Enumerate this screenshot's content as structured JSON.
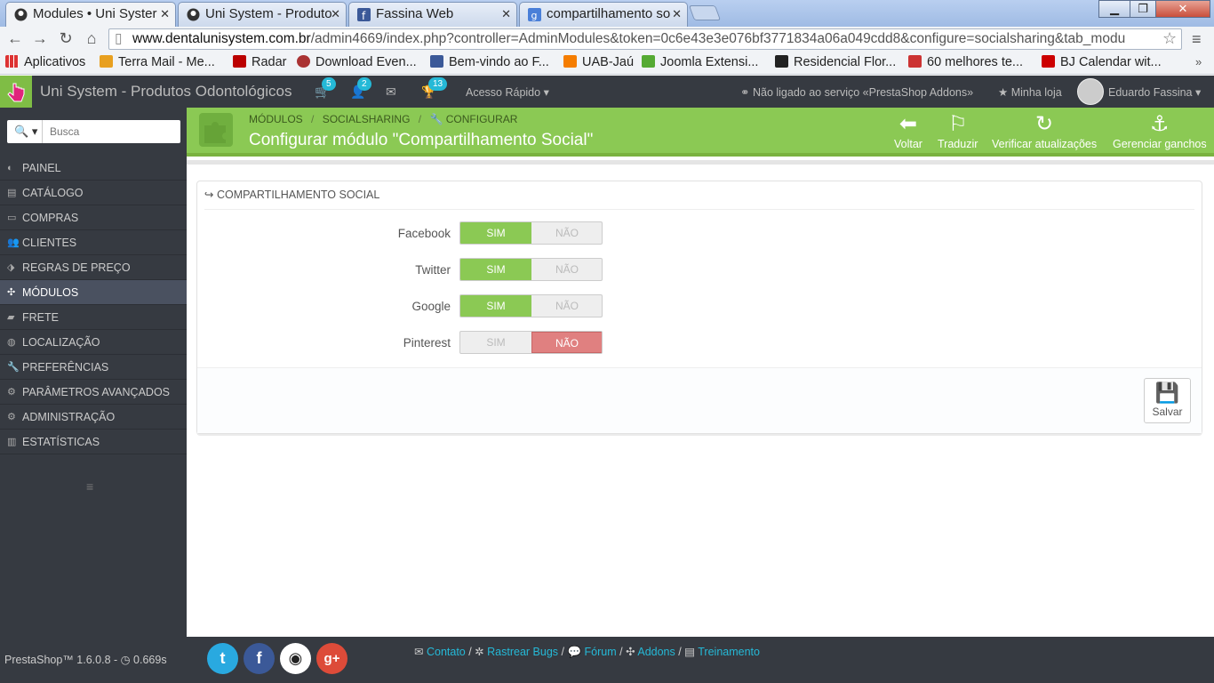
{
  "browser": {
    "tabs": [
      {
        "title": "Modules • Uni Syster",
        "active": true
      },
      {
        "title": "Uni System - Produto"
      },
      {
        "title": "Fassina Web"
      },
      {
        "title": "compartilhamento so"
      }
    ],
    "url_host": "www.dentalunisystem.com.br",
    "url_path": "/admin4669/index.php?controller=AdminModules&token=0c6e43e3e076bf3771834a06a049cdd8&configure=socialsharing&tab_modu",
    "bookmarks": [
      "Aplicativos",
      "Terra Mail - Me...",
      "Radar",
      "Download Even...",
      "Bem-vindo ao F...",
      "UAB-Jaú",
      "Joomla Extensi...",
      "Residencial Flor...",
      "60 melhores te...",
      "BJ Calendar wit..."
    ],
    "bookmark_colors": [
      "#d24",
      "#e8a020",
      "#b00",
      "#a33",
      "#3b5998",
      "#f57d00",
      "#5a3",
      "#222",
      "#c33",
      "#c00"
    ]
  },
  "header": {
    "shop_name": "Uni System - Produtos Odontológicos",
    "badges": {
      "cart": "5",
      "customers": "2",
      "trophy": "13"
    },
    "quick_access": "Acesso Rápido",
    "addons_status": "Não ligado ao serviço «PrestaShop Addons»",
    "my_store": "Minha loja",
    "user": "Eduardo Fassina"
  },
  "sidebar": {
    "search_label": "Q",
    "search_placeholder": "Busca",
    "items": [
      {
        "label": "PAINEL",
        "icon": "dashboard-icon"
      },
      {
        "label": "CATÁLOGO",
        "icon": "book-icon"
      },
      {
        "label": "COMPRAS",
        "icon": "credit-card-icon"
      },
      {
        "label": "CLIENTES",
        "icon": "users-icon"
      },
      {
        "label": "REGRAS DE PREÇO",
        "icon": "tags-icon"
      },
      {
        "label": "MÓDULOS",
        "icon": "puzzle-icon",
        "active": true
      },
      {
        "label": "FRETE",
        "icon": "truck-icon"
      },
      {
        "label": "LOCALIZAÇÃO",
        "icon": "globe-icon"
      },
      {
        "label": "PREFERÊNCIAS",
        "icon": "wrench-icon"
      },
      {
        "label": "PARÂMETROS AVANÇADOS",
        "icon": "cogs-icon"
      },
      {
        "label": "ADMINISTRAÇÃO",
        "icon": "cog-icon"
      },
      {
        "label": "ESTATÍSTICAS",
        "icon": "bar-chart-icon"
      }
    ]
  },
  "toolbar": {
    "breadcrumb": [
      "MÓDULOS",
      "SOCIALSHARING",
      "CONFIGURAR"
    ],
    "title": "Configurar módulo \"Compartilhamento Social\"",
    "buttons": [
      "Voltar",
      "Traduzir",
      "Verificar atualizações",
      "Gerenciar ganchos"
    ]
  },
  "panel": {
    "heading": "COMPARTILHAMENTO SOCIAL",
    "yes": "SIM",
    "no": "NÃO",
    "rows": [
      {
        "label": "Facebook",
        "value": "SIM"
      },
      {
        "label": "Twitter",
        "value": "SIM"
      },
      {
        "label": "Google",
        "value": "SIM"
      },
      {
        "label": "Pinterest",
        "value": "NÃO"
      }
    ],
    "save": "Salvar"
  },
  "footer": {
    "version": "PrestaShop™ 1.6.0.8 - ",
    "time": "0.669s",
    "links": [
      "Contato",
      "Rastrear Bugs",
      "Fórum",
      "Addons",
      "Treinamento"
    ],
    "accent": "#25b9d7"
  },
  "colors": {
    "green": "#8bc954",
    "red": "#e08080",
    "dark": "#363a41"
  }
}
